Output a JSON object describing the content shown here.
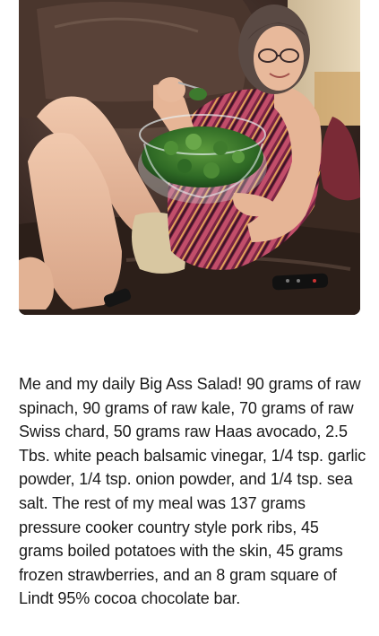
{
  "post": {
    "caption": "Me and my daily Big Ass Salad! 90 grams of raw spinach, 90 grams of raw kale, 70 grams of raw Swiss chard, 50 grams raw Haas avocado, 2.5 Tbs. white peach balsamic vinegar, 1/4 tsp. garlic powder, 1/4 tsp. onion powder, and 1/4 tsp. sea salt. The rest of my meal was 137 grams pressure cooker country style pork ribs, 45 grams boiled potatoes with the skin, 45 grams frozen strawberries, and an 8 gram square of Lindt 95% cocoa chocolate bar."
  },
  "photo": {
    "subject": "woman on brown leather couch holding glass bowl of green salad",
    "palette": {
      "leather": "#3b2a22",
      "leather_highlight": "#6a5245",
      "wall": "#d9c7a7",
      "skin": "#e8b99b",
      "dress": "#8b2a4a",
      "salad": "#3d7a2e",
      "hair": "#5a4a44"
    }
  }
}
